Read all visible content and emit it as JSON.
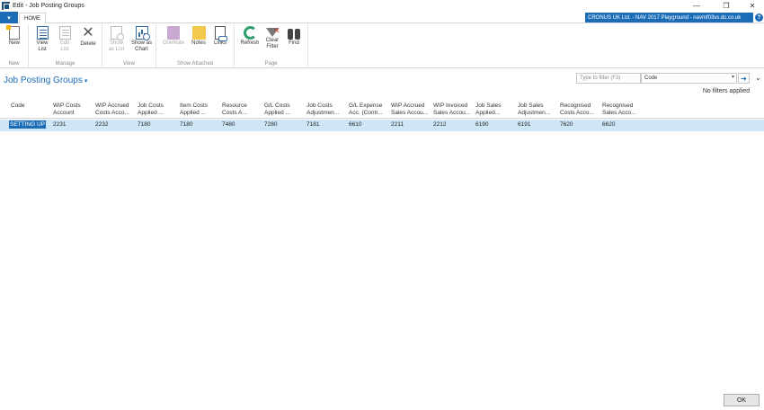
{
  "window": {
    "title": "Edit - Job Posting Groups",
    "minimize": "—",
    "restore": "❐",
    "close": "✕"
  },
  "ribbon_tabs": {
    "file_menu": "▾",
    "home": "HOME",
    "company": "CRONUS UK Ltd. - NAV 2017 Playground - navmf03vs.dc.co.uk",
    "help": "?"
  },
  "ribbon": {
    "groups": {
      "new": "New",
      "manage": "Manage",
      "view": "View",
      "show_attached": "Show Attached",
      "page": "Page"
    },
    "buttons": {
      "new": "New",
      "view_list": [
        "View",
        "List"
      ],
      "edit_list": [
        "Edit",
        "List"
      ],
      "delete": "Delete",
      "show_as_list": [
        "Show",
        "as List"
      ],
      "show_as_chart": [
        "Show as",
        "Chart"
      ],
      "onenote": "OneNote",
      "notes": "Notes",
      "links": "Links",
      "refresh": "Refresh",
      "clear_filter": [
        "Clear",
        "Filter"
      ],
      "find": "Find"
    }
  },
  "page": {
    "title": "Job Posting Groups",
    "title_caret": "▾",
    "filter_placeholder": "Type to filter (F3)",
    "filter_field": "Code",
    "filter_dropdown": "▾",
    "filter_go": "➜",
    "expander": "⌄",
    "no_filters": "No filters applied"
  },
  "table": {
    "columns": [
      [
        "Code",
        ""
      ],
      [
        "WIP Costs",
        "Account"
      ],
      [
        "WIP Accrued",
        "Costs Acco..."
      ],
      [
        "Job Costs",
        "Applied ..."
      ],
      [
        "Item Costs",
        "Applied ..."
      ],
      [
        "Resource",
        "Costs A..."
      ],
      [
        "G/L Costs",
        "Applied ..."
      ],
      [
        "Job Costs",
        "Adjustmen..."
      ],
      [
        "G/L Expense",
        "Acc. (Contr..."
      ],
      [
        "WIP Accrued",
        "Sales Accou..."
      ],
      [
        "WIP Invoiced",
        "Sales Accou..."
      ],
      [
        "Job Sales",
        "Applied..."
      ],
      [
        "Job Sales",
        "Adjustmen..."
      ],
      [
        "Recognised",
        "Costs Acco..."
      ],
      [
        "Recognised",
        "Sales Acco..."
      ]
    ],
    "rows": [
      [
        "SETTING UP",
        "2231",
        "2232",
        "7180",
        "7180",
        "7480",
        "7280",
        "7181",
        "6610",
        "2211",
        "2212",
        "6190",
        "6191",
        "7620",
        "6620"
      ]
    ]
  },
  "footer": {
    "ok": "OK"
  }
}
